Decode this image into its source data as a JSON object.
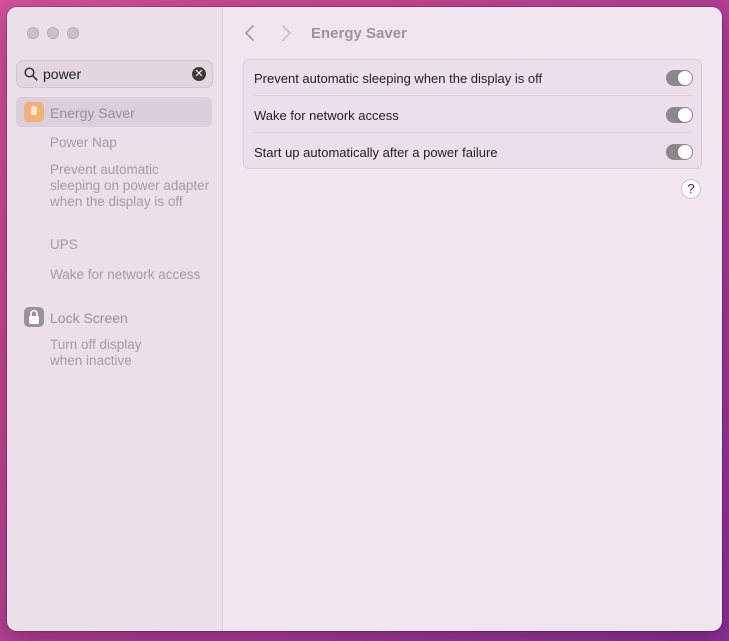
{
  "window": {
    "title": "Energy Saver"
  },
  "search": {
    "value": "power",
    "clear_label": "✕"
  },
  "sidebar": {
    "groups": [
      {
        "label": "Energy Saver",
        "icon": "lightbulb-icon",
        "selected": true,
        "items": [
          "Power Nap",
          "Prevent automatic sleeping on power adapter when the display is off",
          "UPS",
          "Wake for network access"
        ]
      },
      {
        "label": "Lock Screen",
        "icon": "lock-icon",
        "selected": false,
        "items": [
          "Turn off display when inactive"
        ]
      }
    ]
  },
  "settings": [
    {
      "label": "Prevent automatic sleeping when the display is off",
      "on": true
    },
    {
      "label": "Wake for network access",
      "on": true
    },
    {
      "label": "Start up automatically after a power failure",
      "on": true
    }
  ],
  "help": {
    "label": "?"
  },
  "colors": {
    "energy_icon": "#f0b178",
    "toggle_on": "#8e868d"
  }
}
